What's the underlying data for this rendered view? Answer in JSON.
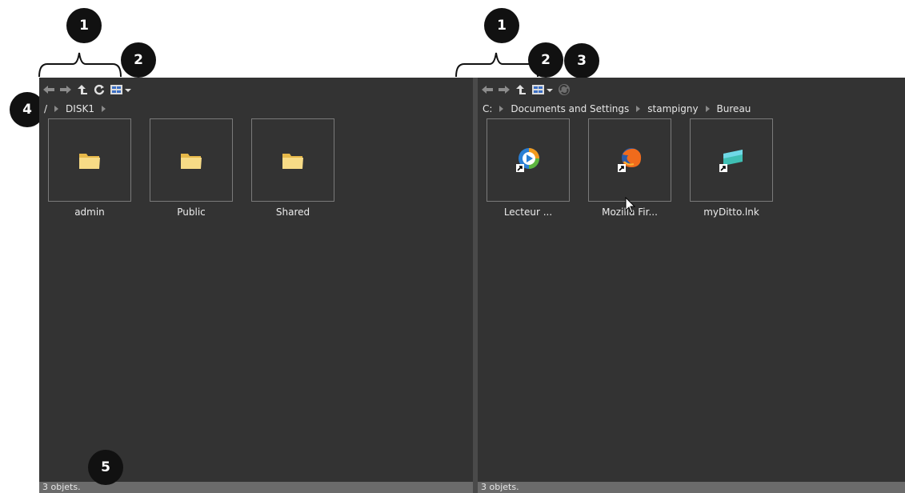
{
  "left_pane": {
    "breadcrumb": [
      "/",
      "DISK1"
    ],
    "items": [
      {
        "label": "admin",
        "icon": "folder-icon"
      },
      {
        "label": "Public",
        "icon": "folder-icon"
      },
      {
        "label": "Shared",
        "icon": "folder-icon"
      }
    ],
    "status": "3 objets."
  },
  "right_pane": {
    "breadcrumb": [
      "C:",
      "Documents and Settings",
      "stampigny",
      "Bureau"
    ],
    "items": [
      {
        "label": "Lecteur ...",
        "icon": "media-player-shortcut-icon"
      },
      {
        "label": "Mozilla Fir...",
        "icon": "firefox-shortcut-icon"
      },
      {
        "label": "myDitto.lnk",
        "icon": "ditto-shortcut-icon"
      }
    ],
    "status": "3 objets."
  },
  "callouts": {
    "one": "1",
    "two": "2",
    "three": "3",
    "four": "4",
    "five": "5"
  },
  "colors": {
    "pane_bg": "#333333",
    "status_bg": "#6b6b6b",
    "callout_bg": "#111111"
  }
}
